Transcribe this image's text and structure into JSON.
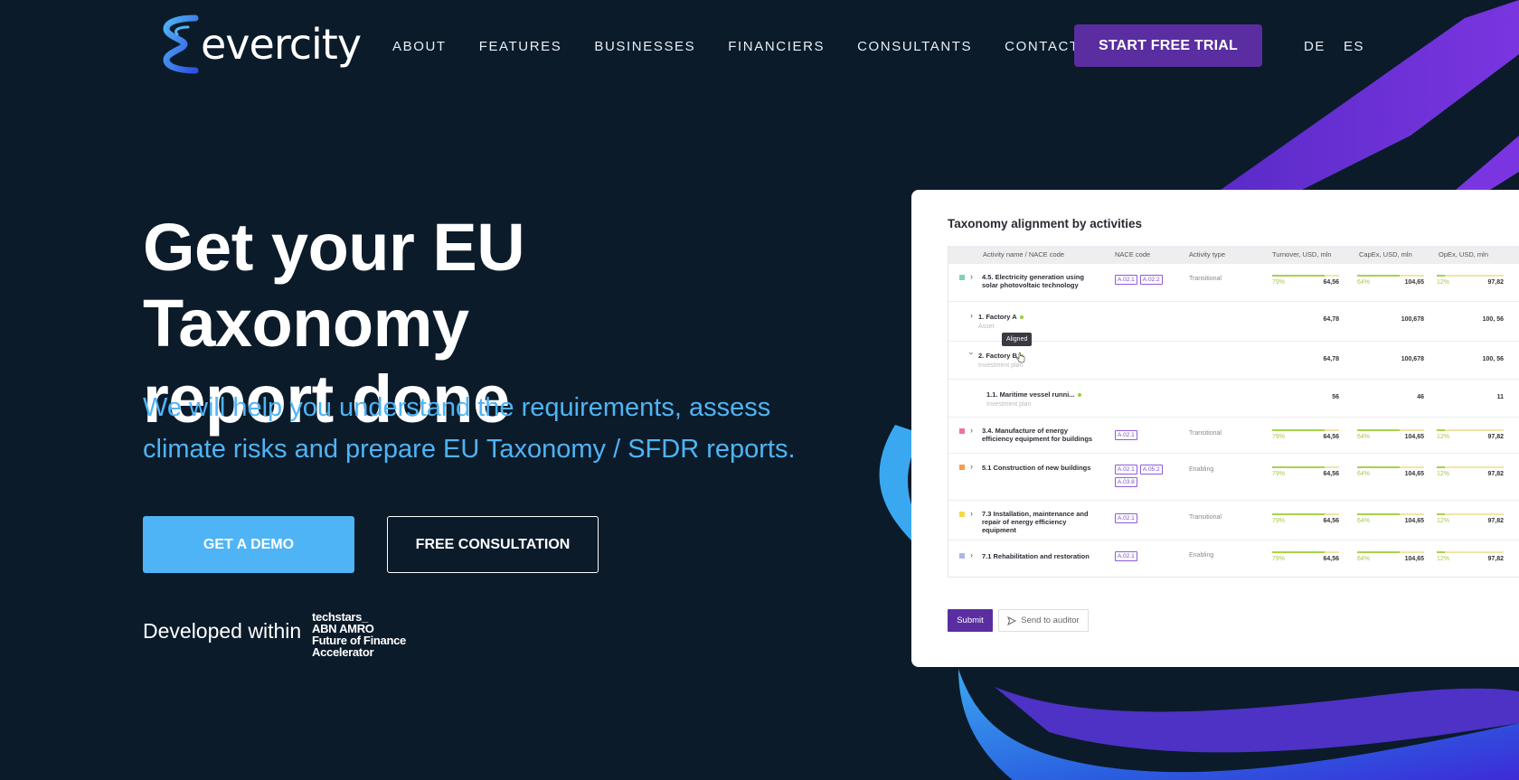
{
  "brand": {
    "name": "evercity",
    "logo_icon": "sigma-ribbon-icon",
    "accent": "#5a2ea0",
    "secondary": "#4fb4f5",
    "background": "#0b1b2a"
  },
  "nav": {
    "items": [
      "ABOUT",
      "FEATURES",
      "BUSINESSES",
      "FINANCIERS",
      "CONSULTANTS",
      "CONTACTS"
    ]
  },
  "header": {
    "cta": "START FREE TRIAL",
    "languages": [
      "DE",
      "ES"
    ]
  },
  "hero": {
    "title_line1": "Get your EU Taxonomy",
    "title_line2": "report done",
    "subtitle_line1": "We will help you understand the requirements, assess",
    "subtitle_line2": "climate risks and prepare EU Taxonomy / SFDR reports.",
    "demo_button": "GET A DEMO",
    "consult_button": "FREE CONSULTATION",
    "developed_within": "Developed within",
    "partner_lines": [
      "techstars_",
      "ABN AMRO",
      "Future of Finance",
      "Accelerator"
    ]
  },
  "dashboard": {
    "title": "Taxonomy alignment by activities",
    "columns": [
      "Activity name / NACE code",
      "NACE code",
      "Activity type",
      "Turnover, USD, mln",
      "CapEx, USD, mln",
      "OpEx, USD, mln"
    ],
    "tooltip": "Aligned",
    "rows": [
      {
        "name": "4.5. Electricity generation using solar photovoltaic technology",
        "color": "#7ed6b0",
        "nace": [
          "A.02.1",
          "A.02.2"
        ],
        "type": "Transitional",
        "turnover_pct": "79%",
        "turnover": "64,56",
        "capex_pct": "64%",
        "capex": "104,65",
        "opex_pct": "12%",
        "opex": "97,82"
      },
      {
        "name": "1. Factory A",
        "sub": "Asset",
        "turnover": "64,78",
        "capex": "100,678",
        "opex": "100, 56"
      },
      {
        "name": "2. Factory B",
        "sub": "Investment plan",
        "turnover": "64,78",
        "capex": "100,678",
        "opex": "100, 56"
      },
      {
        "name": "1.1. Maritime vessel runni...",
        "sub": "Investment plan",
        "turnover": "56",
        "capex": "46",
        "opex": "11"
      },
      {
        "name": "3.4. Manufacture of energy efficiency equipment for buildings",
        "color": "#f06fa6",
        "nace": [
          "A.02.1"
        ],
        "type": "Transitional",
        "turnover_pct": "79%",
        "turnover": "64,56",
        "capex_pct": "64%",
        "capex": "104,65",
        "opex_pct": "12%",
        "opex": "97,82"
      },
      {
        "name": "5.1 Construction of new buildings",
        "color": "#f2a04a",
        "nace": [
          "A.02.1",
          "A.05.2",
          "A.03.8"
        ],
        "type": "Enabling",
        "turnover_pct": "79%",
        "turnover": "64,56",
        "capex_pct": "64%",
        "capex": "104,65",
        "opex_pct": "12%",
        "opex": "97,82"
      },
      {
        "name": "7.3 Installation, maintenance and repair of energy efficiency equipment",
        "color": "#f5d84a",
        "nace": [
          "A.02.1"
        ],
        "type": "Transitional",
        "turnover_pct": "79%",
        "turnover": "64,56",
        "capex_pct": "64%",
        "capex": "104,65",
        "opex_pct": "12%",
        "opex": "97,82"
      },
      {
        "name": "7.1 Rehabilitation and restoration",
        "color": "#a9b7f0",
        "nace": [
          "A.02.1"
        ],
        "type": "Enabling",
        "turnover_pct": "79%",
        "turnover": "64,56",
        "capex_pct": "64%",
        "capex": "104,65",
        "opex_pct": "12%",
        "opex": "97,82"
      }
    ],
    "submit": "Submit",
    "send_auditor": "Send to auditor"
  }
}
